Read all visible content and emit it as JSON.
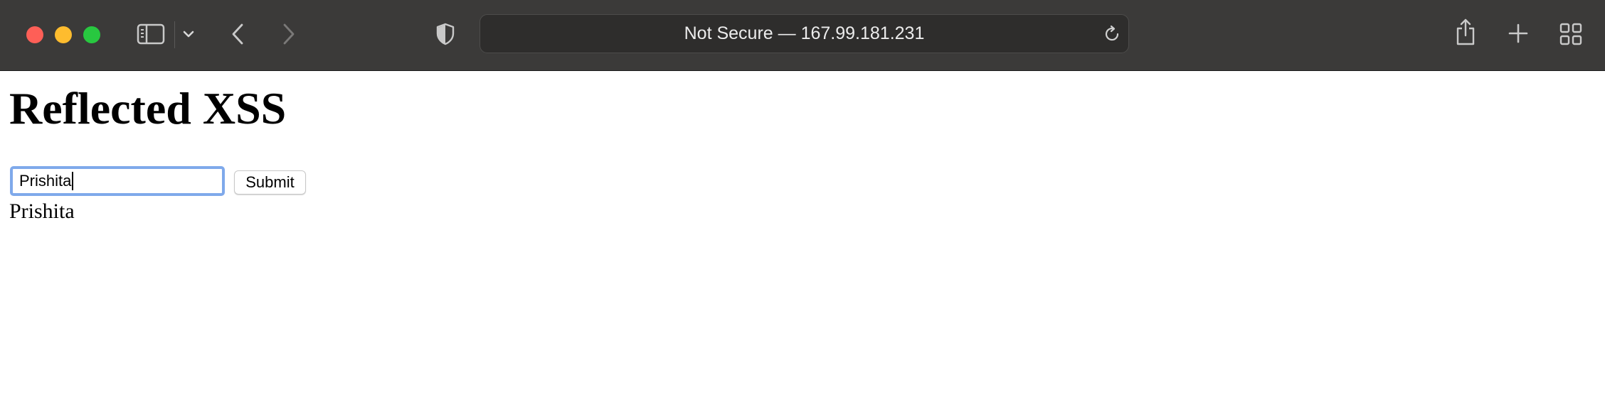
{
  "browser": {
    "address_text": "Not Secure — 167.99.181.231",
    "icons": {
      "close": "close-window-icon",
      "minimize": "minimize-window-icon",
      "zoom": "zoom-window-icon",
      "sidebar": "sidebar-icon",
      "sidebar_menu": "chevron-down-icon",
      "back": "chevron-left-icon",
      "forward": "chevron-right-icon",
      "privacy": "shield-icon",
      "reload": "reload-icon",
      "share": "share-icon",
      "new_tab": "plus-icon",
      "tab_overview": "grid-icon"
    },
    "colors": {
      "toolbar": "#3b3a39",
      "close": "#fe5f57",
      "minimize": "#febc2e",
      "zoom": "#28c840"
    }
  },
  "page": {
    "title": "Reflected XSS",
    "input_value": "Prishita",
    "submit_label": "Submit",
    "reflected_text": "Prishita",
    "focus_ring_color": "#7fa9eb"
  }
}
